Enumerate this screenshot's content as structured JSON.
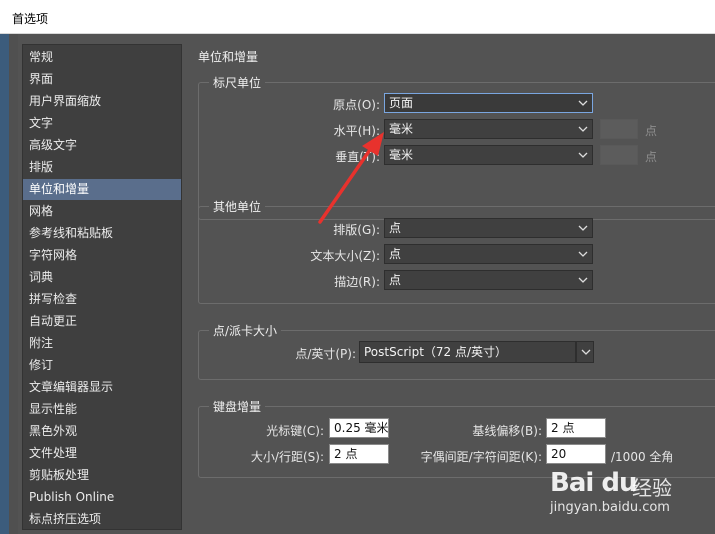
{
  "window": {
    "title": "首选项"
  },
  "sidebar": {
    "items": [
      {
        "label": "常规"
      },
      {
        "label": "界面"
      },
      {
        "label": "用户界面缩放"
      },
      {
        "label": "文字"
      },
      {
        "label": "高级文字"
      },
      {
        "label": "排版"
      },
      {
        "label": "单位和增量",
        "selected": true
      },
      {
        "label": "网格"
      },
      {
        "label": "参考线和粘贴板"
      },
      {
        "label": "字符网格"
      },
      {
        "label": "词典"
      },
      {
        "label": "拼写检查"
      },
      {
        "label": "自动更正"
      },
      {
        "label": "附注"
      },
      {
        "label": "修订"
      },
      {
        "label": "文章编辑器显示"
      },
      {
        "label": "显示性能"
      },
      {
        "label": "黑色外观"
      },
      {
        "label": "文件处理"
      },
      {
        "label": "剪贴板处理"
      },
      {
        "label": "Publish Online"
      },
      {
        "label": "标点挤压选项"
      }
    ]
  },
  "main": {
    "title": "单位和增量",
    "ruler_units": {
      "legend": "标尺单位",
      "origin": {
        "label": "原点(O):",
        "value": "页面"
      },
      "horizontal": {
        "label": "水平(H):",
        "value": "毫米",
        "unit": "点"
      },
      "vertical": {
        "label": "垂直(T):",
        "value": "毫米",
        "unit": "点"
      }
    },
    "other_units": {
      "legend": "其他单位",
      "composition": {
        "label": "排版(G):",
        "value": "点"
      },
      "text_size": {
        "label": "文本大小(Z):",
        "value": "点"
      },
      "stroke": {
        "label": "描边(R):",
        "value": "点"
      }
    },
    "point_pica": {
      "legend": "点/派卡大小",
      "label": "点/英寸(P):",
      "value": "PostScript（72 点/英寸）"
    },
    "keyboard": {
      "legend": "键盘增量",
      "cursor_key": {
        "label": "光标键(C):",
        "value": "0.25 毫米"
      },
      "baseline_shift": {
        "label": "基线偏移(B):",
        "value": "2 点"
      },
      "size_leading": {
        "label": "大小/行距(S):",
        "value": "2 点"
      },
      "kerning": {
        "label": "字偶间距/字符间距(K):",
        "value": "20",
        "suffix": "/1000 全角"
      }
    }
  },
  "watermark": {
    "logo": "Bai du",
    "cn": "经验",
    "url": "jingyan.baidu.com"
  },
  "colors": {
    "accent_red": "#e8322d",
    "selected": "#5a6e8c",
    "focus": "#7aa6e0"
  }
}
